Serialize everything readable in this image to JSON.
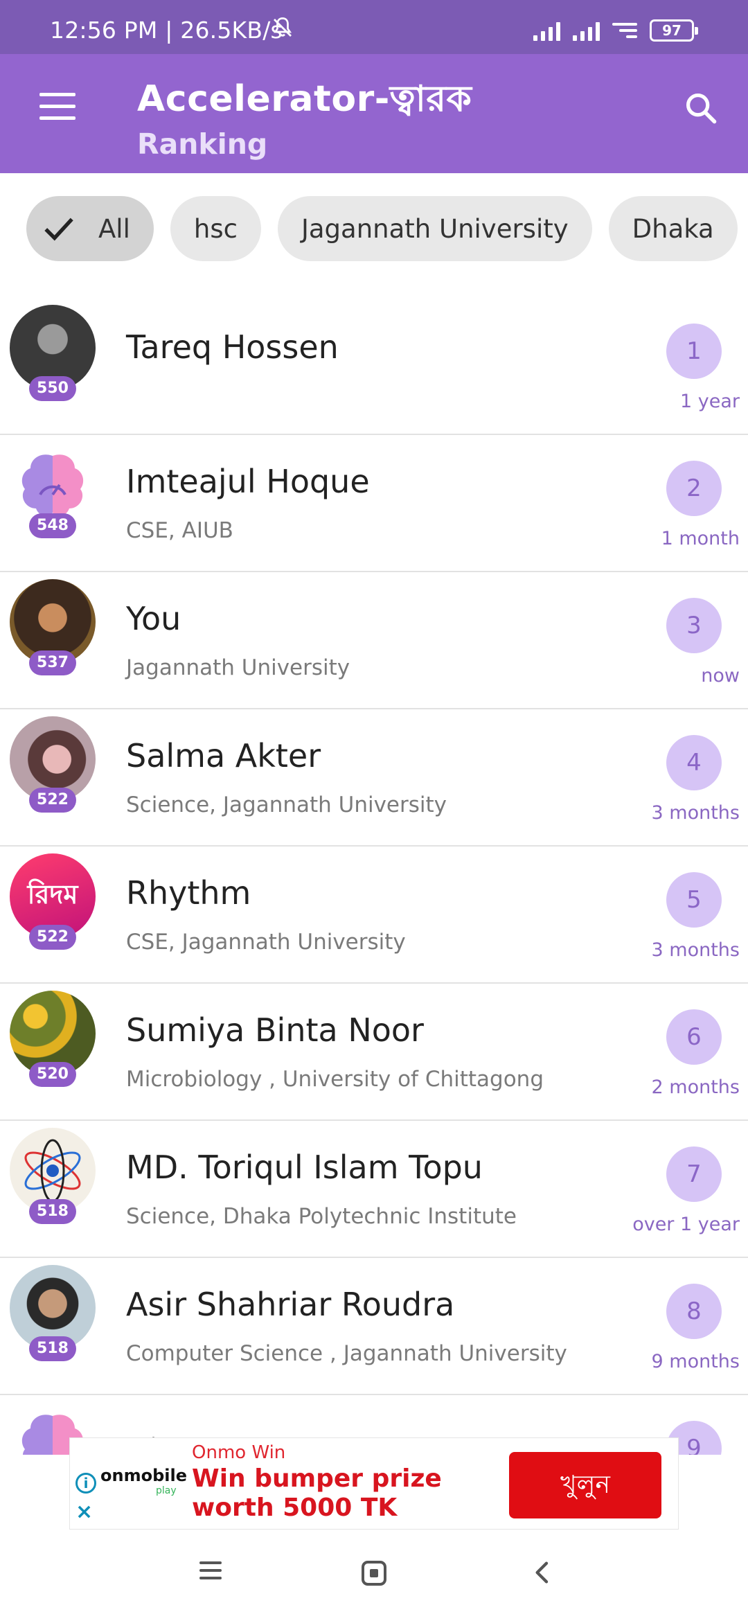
{
  "status_bar": {
    "time_speed": "12:56 PM | 26.5KB/s",
    "battery": "97"
  },
  "app_bar": {
    "title": "Accelerator-ত্বারক",
    "subtitle": "Ranking"
  },
  "filters": [
    {
      "label": "All",
      "selected": true
    },
    {
      "label": "hsc",
      "selected": false
    },
    {
      "label": "Jagannath University",
      "selected": false
    },
    {
      "label": "Dhaka",
      "selected": false
    }
  ],
  "ranking": [
    {
      "name": "Tareq Hossen",
      "subtitle": "",
      "score": "550",
      "rank": "1",
      "time": "1 year"
    },
    {
      "name": "Imteajul Hoque",
      "subtitle": "CSE, AIUB",
      "score": "548",
      "rank": "2",
      "time": "1 month"
    },
    {
      "name": "You",
      "subtitle": "Jagannath University",
      "score": "537",
      "rank": "3",
      "time": "now"
    },
    {
      "name": "Salma Akter",
      "subtitle": "Science, Jagannath University",
      "score": "522",
      "rank": "4",
      "time": "3 months"
    },
    {
      "name": "Rhythm",
      "subtitle": "CSE, Jagannath University",
      "score": "522",
      "rank": "5",
      "time": "3 months",
      "avatar_text": "রিদম"
    },
    {
      "name": "Sumiya Binta Noor",
      "subtitle": "Microbiology , University of Chittagong",
      "score": "520",
      "rank": "6",
      "time": "2 months"
    },
    {
      "name": "MD. Toriqul Islam Topu",
      "subtitle": "Science, Dhaka Polytechnic Institute",
      "score": "518",
      "rank": "7",
      "time": "over 1 year"
    },
    {
      "name": "Asir Shahriar Roudra",
      "subtitle": "Computer Science , Jagannath University",
      "score": "518",
      "rank": "8",
      "time": "9 months"
    },
    {
      "name": "ত্বারক",
      "subtitle": "",
      "score": "",
      "rank": "9",
      "time": ""
    }
  ],
  "ad": {
    "brand": "onmobile",
    "brand_sub": "play",
    "advertiser": "Onmo Win",
    "headline": "Win bumper prize worth 5000 TK",
    "cta": "খুলুন",
    "colors": {
      "cta": "#e00d13",
      "headline": "#d8151f"
    }
  },
  "colors": {
    "status_bar": "#7c5bb4",
    "app_bar": "#9365cf",
    "score_badge": "#8e5bc7",
    "rank_circle": "#d6c4f6"
  }
}
